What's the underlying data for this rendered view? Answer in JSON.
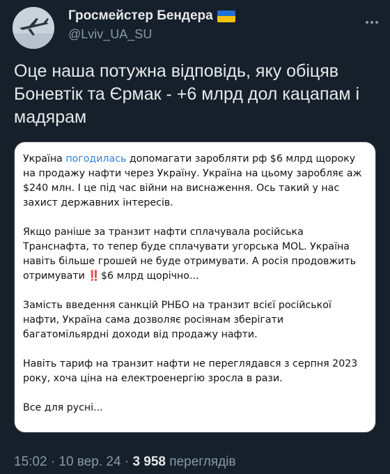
{
  "author": {
    "display_name": "Гросмейстер Бендера",
    "handle": "@Lviv_UA_SU",
    "flag_icon": "ukraine-flag-icon",
    "flag_colors": [
      "#1f6fd6",
      "#f4c20d"
    ]
  },
  "tweet": {
    "text": "Оце наша потужна відповідь, яку обіцяв Боневтік та Єрмак - +6 млрд дол кацапам і мадярам"
  },
  "card": {
    "p1_a": "Україна ",
    "p1_link": "погодилась",
    "p1_b": " допомагати заробляти рф $6 млрд щороку на продажу нафти через Україну. Україна на цьому заробляє аж $240 млн. І це під час війни на виснаження. Ось такий у нас захист державних інтересів.",
    "p2_a": "Якщо раніше за транзит нафти сплачувала російська Транснафта, то тепер буде сплачувати угорська MOL. Україна навіть більше грошей не буде отримувати. А росія продовжить отримувати ",
    "p2_emoji": "‼️",
    "p2_b": "$6 млрд щорічно...",
    "p3": "Замість введення санкцій РНБО на транзит всієї російської нафти, Україна сама дозволяє росіянам зберігати багатомільярдні доходи від продажу нафти.",
    "p4": "Навіть тариф на транзит нафти не переглядався з серпня 2023 року, хоча ціна на електроенергію зросла в рази.",
    "p5": "Все для русні..."
  },
  "meta": {
    "time": "15:02",
    "sep1": " · ",
    "date": "10 вер. 24",
    "sep2": " · ",
    "views": "3 958",
    "views_label": " переглядів"
  },
  "colors": {
    "background": "#15202b",
    "link": "#2b82d9",
    "secondary_text": "#8b98a5"
  }
}
